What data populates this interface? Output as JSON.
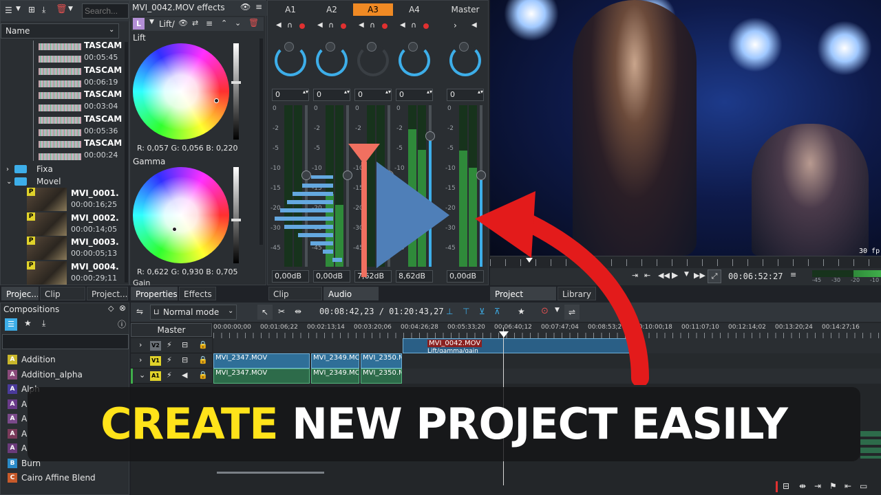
{
  "bin": {
    "search_placeholder": "Search...",
    "column_name": "Name",
    "audio_items": [
      {
        "name": "TASCAM",
        "duration": "00:05:45"
      },
      {
        "name": "TASCAM",
        "duration": "00:06:19"
      },
      {
        "name": "TASCAM",
        "duration": "00:03:04"
      },
      {
        "name": "TASCAM",
        "duration": "00:05:36"
      },
      {
        "name": "TASCAM",
        "duration": "00:00:24"
      }
    ],
    "folders": [
      "Fixa",
      "Movel"
    ],
    "video_items": [
      {
        "name": "MVI_0001.",
        "duration": "00:00:16;25",
        "badge": "P"
      },
      {
        "name": "MVI_0002.",
        "duration": "00:00:14;05",
        "badge": "P"
      },
      {
        "name": "MVI_0003.",
        "duration": "00:00:05;13",
        "badge": "P"
      },
      {
        "name": "MVI_0004.",
        "duration": "00:00:29;11",
        "badge": "P"
      }
    ],
    "tabs": [
      "Projec...",
      "Clip Pro...",
      "Project..."
    ]
  },
  "effects": {
    "title": "MVI_0042.MOV effects",
    "effect_badge": "L",
    "effect_name": "Lift/",
    "lift_label": "Lift",
    "lift_values": "R: 0,057   G: 0,056   B: 0,220",
    "gamma_label": "Gamma",
    "gamma_values": "R: 0,622   G: 0,930   B: 0,705",
    "gain_label": "Gain",
    "tabs": [
      "Properties",
      "Effects"
    ]
  },
  "mixer": {
    "channels": [
      {
        "name": "A1",
        "gain": "0",
        "db": "0,00dB",
        "level": 0.0
      },
      {
        "name": "A2",
        "gain": "0",
        "db": "0,00dB",
        "level": 0.45
      },
      {
        "name": "A3",
        "gain": "0",
        "db": "7,62dB",
        "level": 0.0
      },
      {
        "name": "A4",
        "gain": "0",
        "db": "8,62dB",
        "level": 0.85
      }
    ],
    "master": {
      "name": "Master",
      "gain": "0",
      "db": "0,00dB",
      "level": 0.72
    },
    "scale": [
      "0",
      "-2",
      "-5",
      "-10",
      "-15",
      "-20",
      "-30",
      "-45"
    ],
    "tabs": [
      "Clip Monitor",
      "Audio Mixer"
    ],
    "active_channel": "A3"
  },
  "monitor": {
    "fps_label": "30 fp",
    "timecode": "00:06:52:27",
    "meter_scale": [
      "-45",
      "-30",
      "-20",
      "-10"
    ],
    "tabs": [
      "Project Monitor",
      "Library"
    ]
  },
  "compositions": {
    "title": "Compositions",
    "items": [
      {
        "label": "Addition",
        "badge": "A",
        "color": "#c8b62a"
      },
      {
        "label": "Addition_alpha",
        "badge": "A",
        "color": "#8a4a7a"
      },
      {
        "label": "Alph",
        "badge": "A",
        "color": "#4a3a9a"
      },
      {
        "label": "A",
        "badge": "A",
        "color": "#6a3a8a"
      },
      {
        "label": "A",
        "badge": "A",
        "color": "#7a4a8a"
      },
      {
        "label": "A",
        "badge": "A",
        "color": "#7a3a5a"
      },
      {
        "label": "A",
        "badge": "A",
        "color": "#6a3a7a"
      },
      {
        "label": "Burn",
        "badge": "B",
        "color": "#2a8ac8"
      },
      {
        "label": "Cairo Affine Blend",
        "badge": "C",
        "color": "#c85a2a"
      }
    ]
  },
  "timeline": {
    "mode": "Normal mode",
    "position": "00:08:42,23 / 01:20:43,27",
    "master_label": "Master",
    "tracks": [
      "V2",
      "V1",
      "A1"
    ],
    "ruler": [
      "00:00:00;00",
      "00:01:06;22",
      "00:02:13;14",
      "00:03:20;06",
      "00:04:26;28",
      "00:05:33;20",
      "00:06:40;12",
      "00:07:47;04",
      "00:08:53;26",
      "00:10:00;18",
      "00:11:07;10",
      "00:12:14;02",
      "00:13:20;24",
      "00:14:27;16"
    ],
    "v2_clip": {
      "name": "MVI_0042.MOV",
      "effect": "Lift/gamma/gain"
    },
    "v1_clips": [
      "MVI_2347.MOV",
      "MVI_2349.MOV",
      "MVI_2350.MOV"
    ],
    "a1_clips": [
      "MVI_2347.MOV",
      "MVI_2349.MOV",
      "MVI_2350.MOV"
    ]
  },
  "overlay": {
    "highlight": "CREATE",
    "rest": "NEW PROJECT EASILY"
  },
  "colors": {
    "accent": "#3daee9",
    "active_tab": "#f08a24",
    "highlight_text": "#ffe31a",
    "arrow": "#e31b1b",
    "play_icon": "#4f7fb8",
    "playhead_marker": "#f07060"
  }
}
